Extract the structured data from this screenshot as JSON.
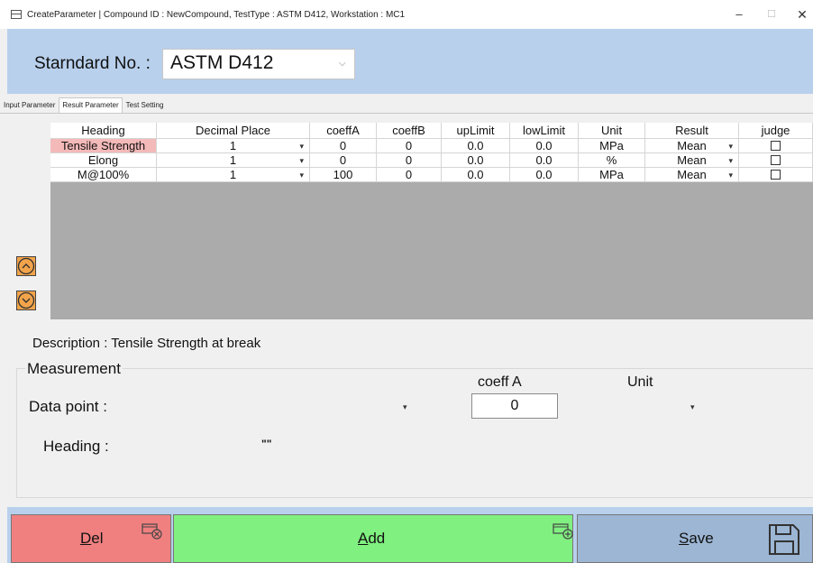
{
  "window": {
    "title": "CreateParameter | Compound ID : NewCompound, TestType : ASTM D412, Workstation : MC1",
    "minimize_glyph": "–",
    "maximize_glyph": "☐",
    "close_glyph": "✕"
  },
  "header": {
    "standard_label": "Starndard No. :",
    "standard_value": "ASTM D412"
  },
  "tabs": [
    {
      "label": "Input Parameter",
      "active": false
    },
    {
      "label": "Result Parameter",
      "active": true
    },
    {
      "label": "Test Setting",
      "active": false
    }
  ],
  "grid": {
    "columns": [
      "Heading",
      "Decimal Place",
      "coeffA",
      "coeffB",
      "upLimit",
      "lowLimit",
      "Unit",
      "Result",
      "judge"
    ],
    "rows": [
      {
        "heading": "Tensile Strength",
        "decimal": "1",
        "coeffA": "0",
        "coeffB": "0",
        "upLimit": "0.0",
        "lowLimit": "0.0",
        "unit": "MPa",
        "result": "Mean",
        "judge": false,
        "selected": true
      },
      {
        "heading": "Elong",
        "decimal": "1",
        "coeffA": "0",
        "coeffB": "0",
        "upLimit": "0.0",
        "lowLimit": "0.0",
        "unit": "%",
        "result": "Mean",
        "judge": false,
        "selected": false
      },
      {
        "heading": "M@100%",
        "decimal": "1",
        "coeffA": "100",
        "coeffB": "0",
        "upLimit": "0.0",
        "lowLimit": "0.0",
        "unit": "MPa",
        "result": "Mean",
        "judge": false,
        "selected": false
      }
    ]
  },
  "description": "Description : Tensile Strength at break",
  "measurement": {
    "group_label": "Measurement",
    "coeff_label": "coeff A",
    "unit_label": "Unit",
    "data_point_label": "Data point :",
    "coeff_value": "0",
    "heading_label": "Heading :",
    "heading_value": "\"\""
  },
  "buttons": {
    "del": {
      "accel": "D",
      "rest": "el"
    },
    "add": {
      "accel": "A",
      "rest": "dd"
    },
    "save": {
      "accel": "S",
      "rest": "ave"
    }
  },
  "colors": {
    "header_band": "#b8d0ec",
    "selected_cell": "#f4b9b9",
    "grid_empty": "#ababab",
    "del_button": "#f08080",
    "add_button": "#80f080",
    "save_button": "#9cb6d4",
    "nav_button": "#f3a44a"
  }
}
